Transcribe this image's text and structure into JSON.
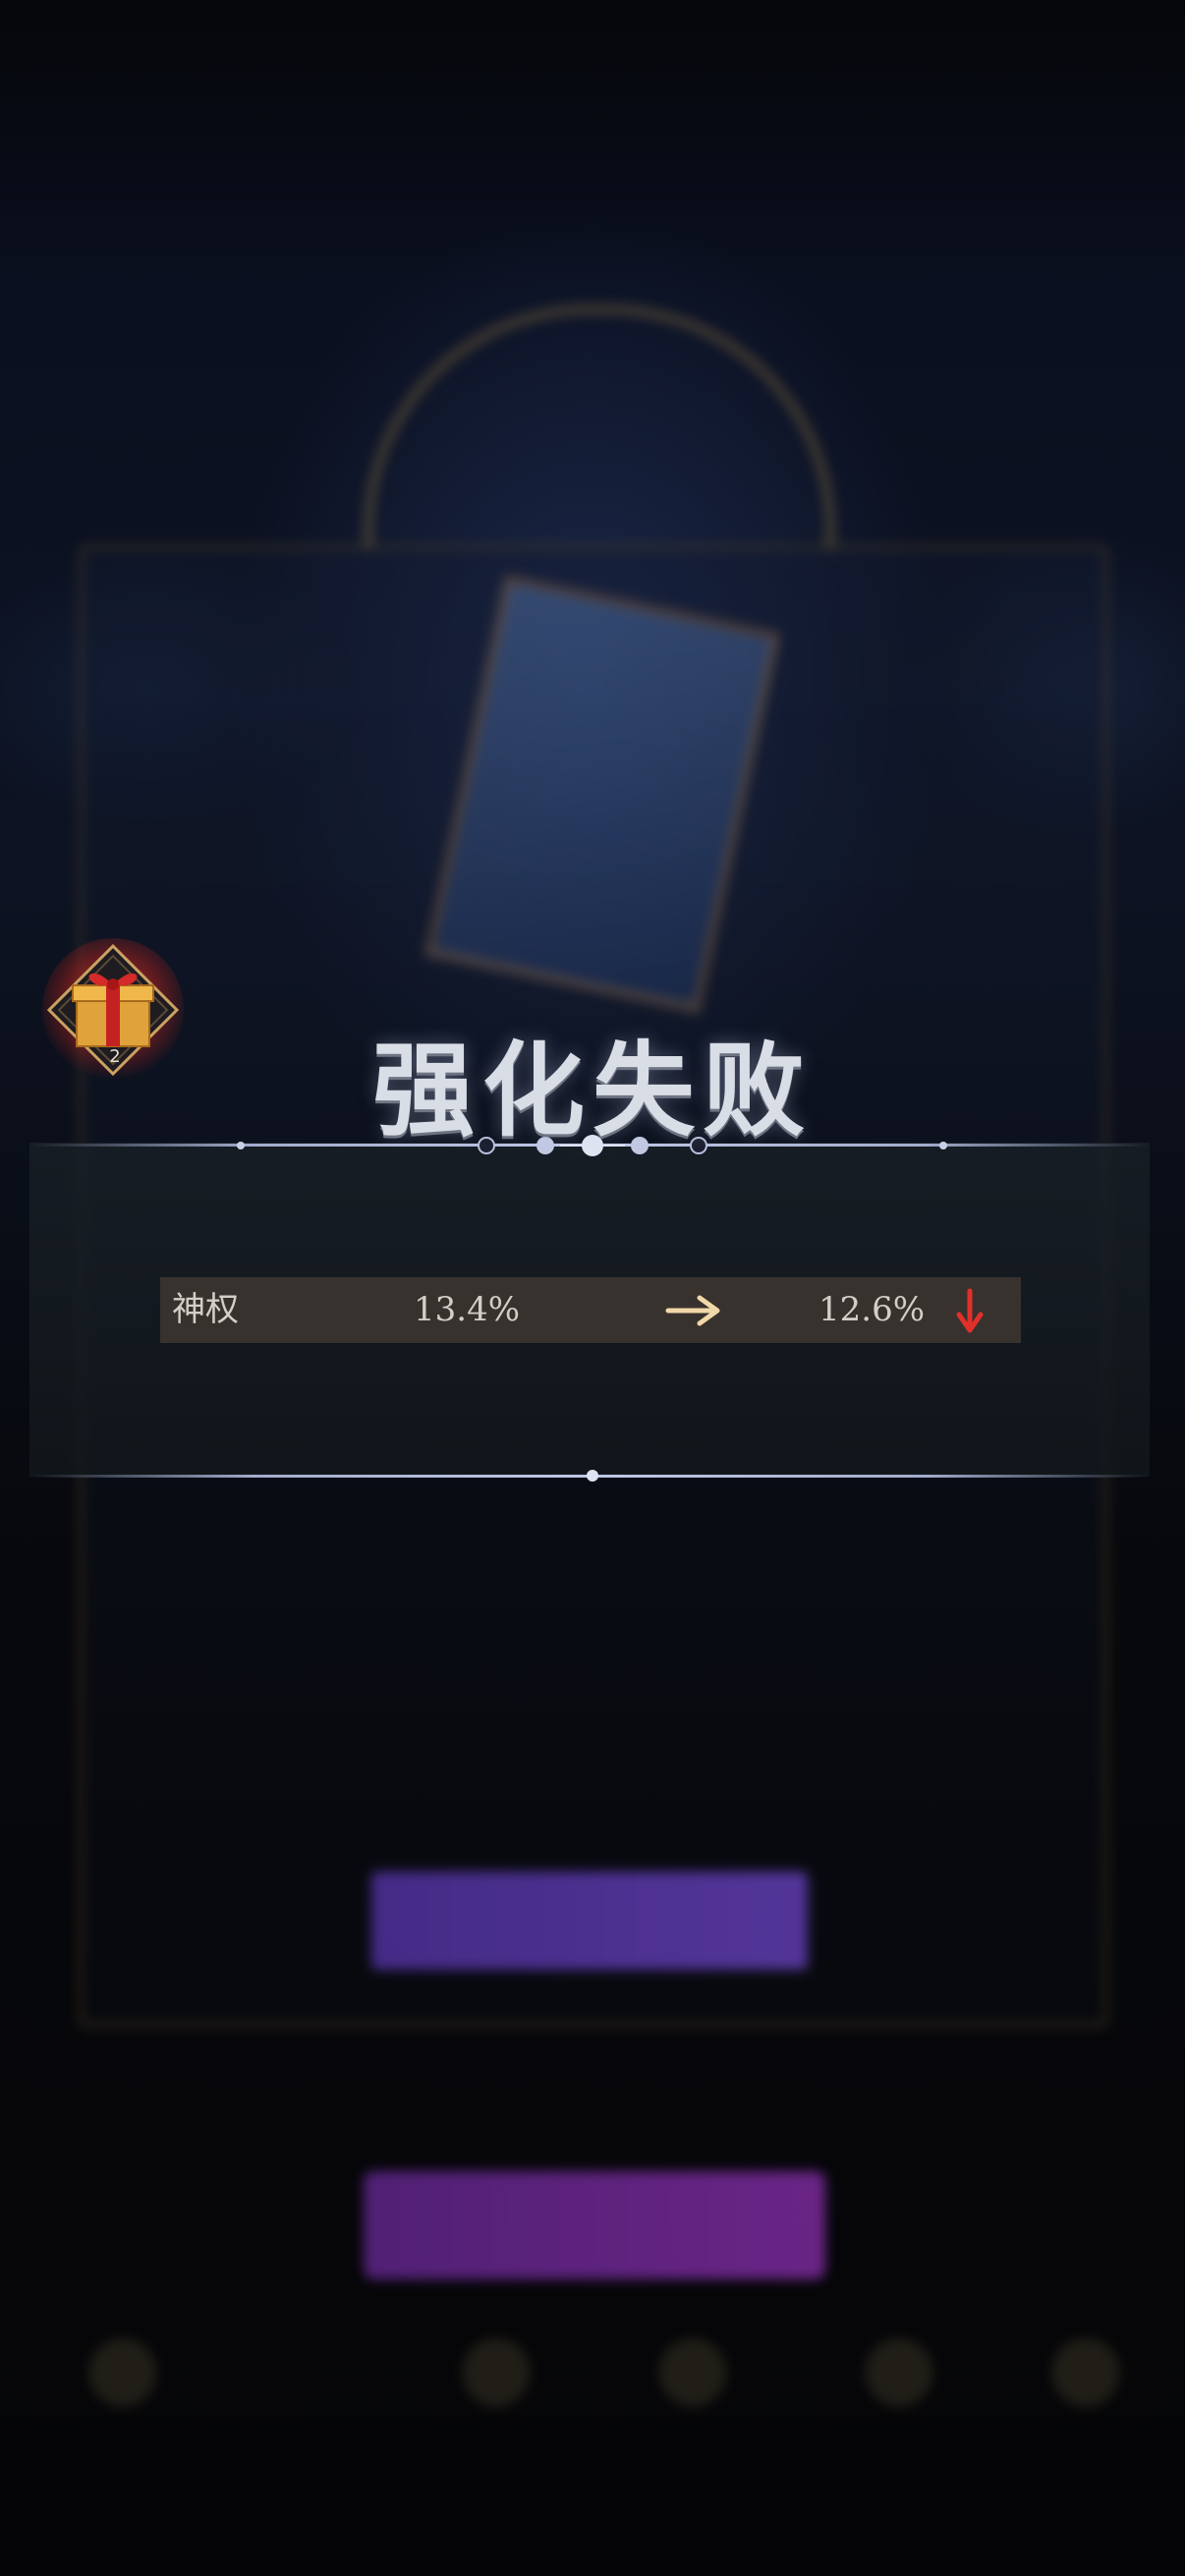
{
  "background": {
    "top_label": "",
    "crown_label": "",
    "sub_label": "",
    "percent_label": "",
    "detail_line": "",
    "enhance_button": "",
    "bottom_gold_label": "",
    "bottom_button": ""
  },
  "result": {
    "title": "强化失败",
    "stat_name": "神权",
    "old_value": "13.4%",
    "new_value": "12.6%"
  },
  "gift": {
    "count": "2"
  },
  "colors": {
    "title": "#d9dde6",
    "down_arrow": "#e0302a",
    "right_arrow": "#f0d8a8",
    "stat_row_bg": "#463c34"
  }
}
